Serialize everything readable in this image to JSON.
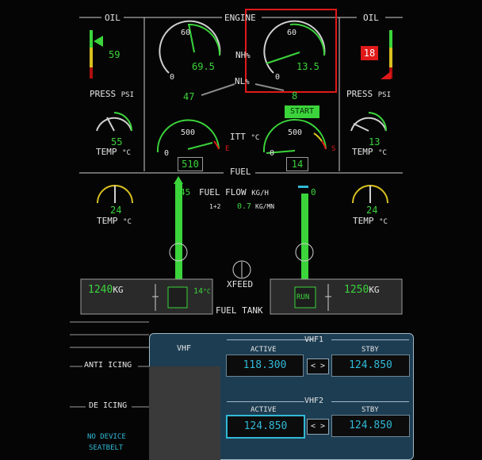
{
  "oil_left": {
    "title": "OIL",
    "value": "59",
    "press_label": "PRESS",
    "press_unit": "PSI",
    "temp_value": "55",
    "temp_label": "TEMP",
    "temp_unit": "°C"
  },
  "oil_right": {
    "title": "OIL",
    "value": "18",
    "press_label": "PRESS",
    "press_unit": "PSI",
    "temp_value": "13",
    "temp_label": "TEMP",
    "temp_unit": "°C"
  },
  "engine": {
    "title": "ENGINE",
    "nh_label": "NH",
    "nl_label": "NL",
    "pct": "%",
    "left_nh_value": "69.5",
    "right_nh_value": "13.5",
    "left_nl_value": "47",
    "right_nl_value": "8",
    "scale_60": "60",
    "scale_0": "0",
    "start_label": "START",
    "itt_label": "ITT",
    "itt_unit": "°C",
    "itt_scale": "500",
    "itt_e": "E",
    "itt_s": "S",
    "left_itt_value": "510",
    "right_itt_value": "14"
  },
  "fuel": {
    "title": "FUEL",
    "flow_label": "FUEL FLOW",
    "flow_unit": "KG/H",
    "left_flow": "45",
    "right_flow": "0",
    "sum_label": "1+2",
    "sum_value": "0.7",
    "sum_unit": "KG/MN",
    "left_temp_value": "24",
    "right_temp_value": "24",
    "temp_label": "TEMP",
    "temp_unit": "°C",
    "left_tank_value": "1240",
    "right_tank_value": "1250",
    "tank_unit": "KG",
    "tank_temp": "14",
    "tank_temp_unit": "°C",
    "xfeed_label": "XFEED",
    "run_label": "RUN",
    "fuel_tank_label": "FUEL TANK"
  },
  "left_menu": {
    "anti_icing": "ANTI ICING",
    "de_icing": "DE ICING",
    "no_device": "NO DEVICE",
    "seatbelt": "SEATBELT"
  },
  "vhf": {
    "title": "VHF",
    "vhf1": {
      "label": "VHF1",
      "active_label": "ACTIVE",
      "stby_label": "STBY",
      "active": "118.300",
      "stby": "124.850",
      "swap": "< >"
    },
    "vhf2": {
      "label": "VHF2",
      "active_label": "ACTIVE",
      "stby_label": "STBY",
      "active": "124.850",
      "stby": "124.850",
      "swap": "< >"
    }
  },
  "colors": {
    "green": "#3bd43b",
    "cyan": "#31b9d6",
    "red": "#e01919",
    "amber": "#d8c020",
    "panel": "#1d3d52",
    "highlight": "#e01919"
  }
}
